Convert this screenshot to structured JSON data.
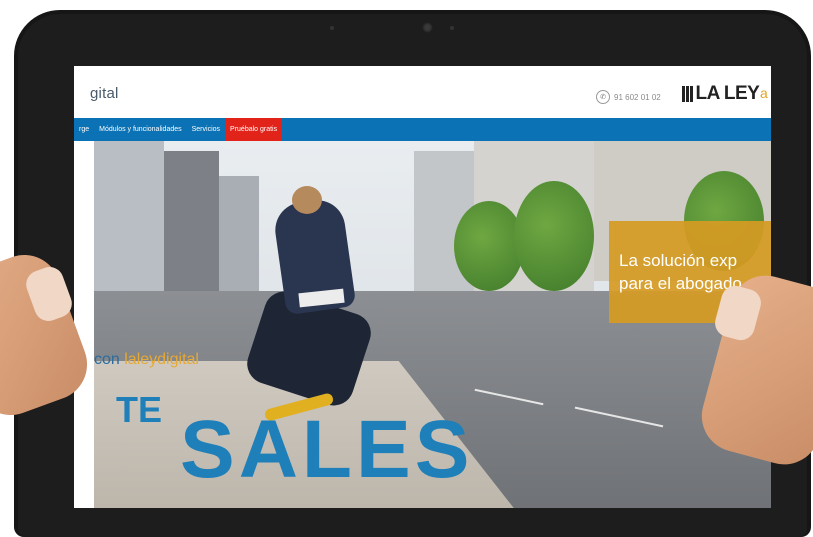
{
  "site": {
    "logo_text": "gital",
    "phone_number": "91 602 01 02",
    "brand_name": "LA LEY",
    "brand_tail": "a"
  },
  "nav": {
    "items": [
      {
        "label": "rge"
      },
      {
        "label": "Módulos y funcionalidades"
      },
      {
        "label": "Servicios"
      },
      {
        "label": "Pruébalo gratis"
      }
    ]
  },
  "hero": {
    "promo_line1": "La solución exp",
    "promo_line2": "para el abogado",
    "tagline_prefix": "con ",
    "tagline_brand": "laleydigital",
    "headline_small": "TE",
    "headline_large": "SALES"
  },
  "colors": {
    "nav_bg": "#0b72b5",
    "cta_bg": "#e2231a",
    "accent": "#1e7fb9",
    "promo_bg": "#d69b23"
  }
}
